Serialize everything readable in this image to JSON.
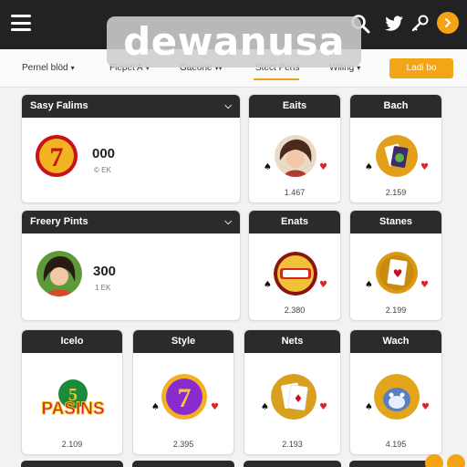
{
  "watermark": "dewanusa",
  "filters": [
    {
      "label": "Pernel blöd",
      "chevron": "▾"
    },
    {
      "label": "Fiepet A",
      "chevron": "▾"
    },
    {
      "label": "Gaeone",
      "chevron": "▾▾"
    },
    {
      "label": "Stect Pens",
      "chevron": ""
    },
    {
      "label": "Wiling",
      "chevron": "▾"
    }
  ],
  "filter_cta": "Ladi bo",
  "cards": [
    {
      "title": "Sasy Falims",
      "value": "000",
      "sub": "© EK",
      "footer": ""
    },
    {
      "title": "Eaits",
      "footer": "1.467"
    },
    {
      "title": "Bach",
      "footer": "2.159"
    },
    {
      "title": "Freery Pints",
      "value": "300",
      "sub": "1 EK",
      "footer": ""
    },
    {
      "title": "Enats",
      "footer": "2.380"
    },
    {
      "title": "Stanes",
      "footer": "2.199"
    },
    {
      "title": "Icelo",
      "art_text": "PASINS",
      "footer": "2.109"
    },
    {
      "title": "Style",
      "footer": "2.395"
    },
    {
      "title": "Nets",
      "footer": "2.193"
    },
    {
      "title": "Wach",
      "footer": "4.195"
    }
  ],
  "icons": {
    "menu": "hamburger-menu-icon",
    "search": "search-icon",
    "bird": "twitter-bird-icon",
    "key": "key-icon",
    "coin": "coin-icon",
    "dropdown": "chevron-down-icon",
    "spade": "♠",
    "heart": "♥"
  },
  "colors": {
    "topbar": "#222222",
    "accent": "#f3a314",
    "card_header": "#2b2b2b",
    "heart": "#d9262a"
  }
}
